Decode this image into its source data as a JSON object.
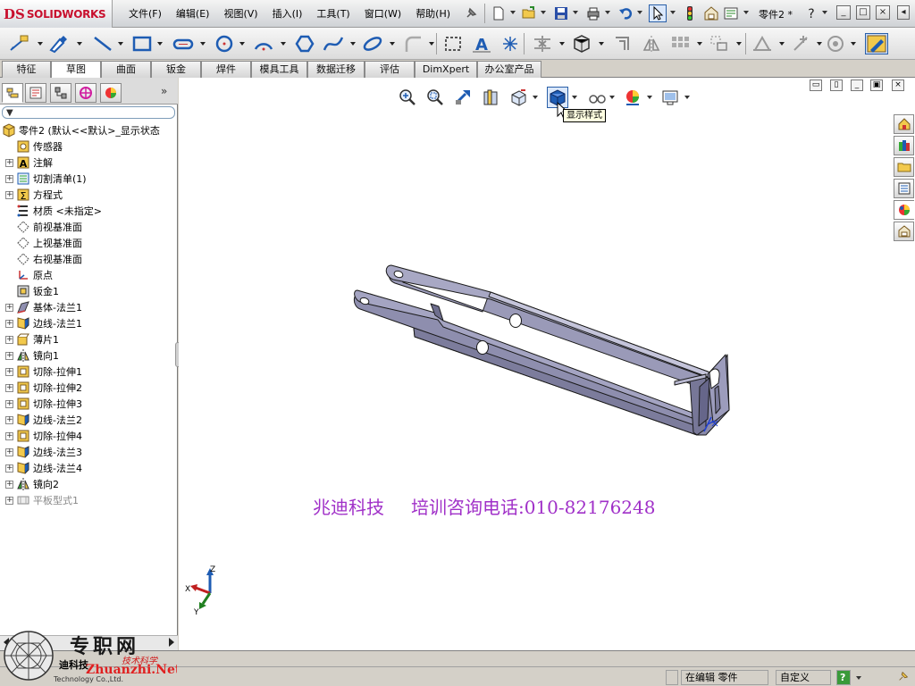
{
  "app": {
    "logo_ds": "DS",
    "logo_text": "SOLIDWORKS",
    "part_name": "零件2 *"
  },
  "menu": [
    "文件(F)",
    "编辑(E)",
    "视图(V)",
    "插入(I)",
    "工具(T)",
    "窗口(W)",
    "帮助(H)"
  ],
  "tabs": [
    "特征",
    "草图",
    "曲面",
    "钣金",
    "焊件",
    "模具工具",
    "数据迁移",
    "评估",
    "DimXpert",
    "办公室产品"
  ],
  "active_tab": "草图",
  "feature_tree": [
    {
      "label": "零件2  (默认<<默认>_显示状态",
      "icon": "part-icon",
      "expand": "none",
      "level": 0
    },
    {
      "label": "传感器",
      "icon": "sensor-icon",
      "expand": "none",
      "level": 1
    },
    {
      "label": "注解",
      "icon": "annotation-icon",
      "expand": "+",
      "level": 1
    },
    {
      "label": "切割清单(1)",
      "icon": "cutlist-icon",
      "expand": "+",
      "level": 1
    },
    {
      "label": "方程式",
      "icon": "equation-icon",
      "expand": "+",
      "level": 1
    },
    {
      "label": "材质 <未指定>",
      "icon": "material-icon",
      "expand": "none",
      "level": 1
    },
    {
      "label": "前视基准面",
      "icon": "plane-icon",
      "expand": "none",
      "level": 1
    },
    {
      "label": "上视基准面",
      "icon": "plane-icon",
      "expand": "none",
      "level": 1
    },
    {
      "label": "右视基准面",
      "icon": "plane-icon",
      "expand": "none",
      "level": 1
    },
    {
      "label": "原点",
      "icon": "origin-icon",
      "expand": "none",
      "level": 1
    },
    {
      "label": "钣金1",
      "icon": "sheetmetal-icon",
      "expand": "none",
      "level": 1
    },
    {
      "label": "基体-法兰1",
      "icon": "base-flange-icon",
      "expand": "+",
      "level": 1
    },
    {
      "label": "边线-法兰1",
      "icon": "edge-flange-icon",
      "expand": "+",
      "level": 1
    },
    {
      "label": "薄片1",
      "icon": "tab-feature-icon",
      "expand": "+",
      "level": 1
    },
    {
      "label": "镜向1",
      "icon": "mirror-icon",
      "expand": "+",
      "level": 1
    },
    {
      "label": "切除-拉伸1",
      "icon": "extruded-cut-icon",
      "expand": "+",
      "level": 1
    },
    {
      "label": "切除-拉伸2",
      "icon": "extruded-cut-icon",
      "expand": "+",
      "level": 1
    },
    {
      "label": "切除-拉伸3",
      "icon": "extruded-cut-icon",
      "expand": "+",
      "level": 1
    },
    {
      "label": "边线-法兰2",
      "icon": "edge-flange-icon",
      "expand": "+",
      "level": 1
    },
    {
      "label": "切除-拉伸4",
      "icon": "extruded-cut-icon",
      "expand": "+",
      "level": 1
    },
    {
      "label": "边线-法兰3",
      "icon": "edge-flange-icon",
      "expand": "+",
      "level": 1
    },
    {
      "label": "边线-法兰4",
      "icon": "edge-flange-icon",
      "expand": "+",
      "level": 1
    },
    {
      "label": "镜向2",
      "icon": "mirror-icon",
      "expand": "+",
      "level": 1
    },
    {
      "label": "平板型式1",
      "icon": "flat-pattern-icon",
      "expand": "+",
      "level": 1,
      "dim": true
    }
  ],
  "viewport": {
    "tooltip": "显示样式",
    "watermark_company": "兆迪科技",
    "watermark_phone": "培训咨询电话:010-82176248",
    "triad": {
      "x": "X",
      "y": "Y",
      "z": "Z"
    }
  },
  "status": {
    "editing": "在编辑 零件",
    "units": "自定义"
  },
  "brand": {
    "logo_text": "专职网",
    "company": "迪科技",
    "site": "Zhuanzhi.Net",
    "slogan": "技术科学",
    "sub": "Technology Co.,Ltd."
  },
  "colors": {
    "part_face": "#8f8fb0",
    "part_edge": "#222222",
    "watermark": "#a030c8",
    "logo_red": "#c8102e"
  }
}
